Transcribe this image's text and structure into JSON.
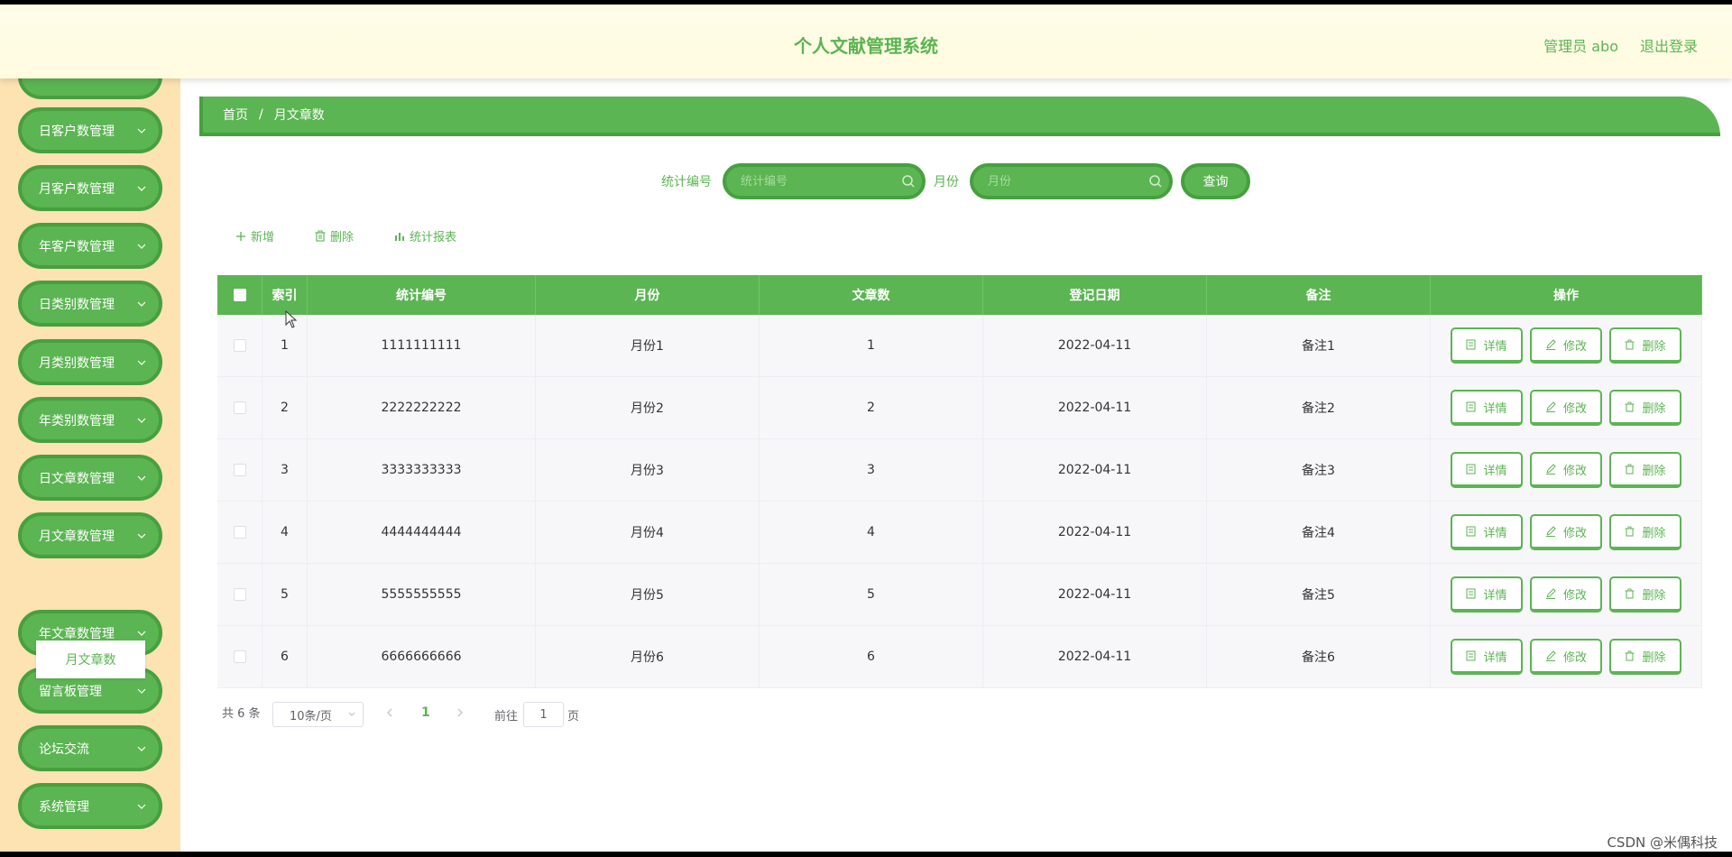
{
  "header": {
    "title": "个人文献管理系统",
    "user": "管理员 abo",
    "logout": "退出登录"
  },
  "sidebar": {
    "items": [
      {
        "label": "日客户数管理"
      },
      {
        "label": "月客户数管理"
      },
      {
        "label": "年客户数管理"
      },
      {
        "label": "日类别数管理"
      },
      {
        "label": "月类别数管理"
      },
      {
        "label": "年类别数管理"
      },
      {
        "label": "日文章数管理"
      },
      {
        "label": "月文章数管理"
      },
      {
        "label": "年文章数管理"
      },
      {
        "label": "留言板管理"
      },
      {
        "label": "论坛交流"
      },
      {
        "label": "系统管理"
      }
    ],
    "submenu": "月文章数"
  },
  "breadcrumb": {
    "home": "首页",
    "separator": "/",
    "current": "月文章数"
  },
  "search": {
    "code_label": "统计编号",
    "code_placeholder": "统计编号",
    "month_label": "月份",
    "month_placeholder": "月份",
    "query": "查询"
  },
  "toolbar": {
    "add": "新增",
    "delete": "删除",
    "report": "统计报表"
  },
  "table": {
    "columns": [
      "索引",
      "统计编号",
      "月份",
      "文章数",
      "登记日期",
      "备注",
      "操作"
    ],
    "rows": [
      {
        "index": "1",
        "code": "1111111111",
        "month": "月份1",
        "count": "1",
        "date": "2022-04-11",
        "note": "备注1"
      },
      {
        "index": "2",
        "code": "2222222222",
        "month": "月份2",
        "count": "2",
        "date": "2022-04-11",
        "note": "备注2"
      },
      {
        "index": "3",
        "code": "3333333333",
        "month": "月份3",
        "count": "3",
        "date": "2022-04-11",
        "note": "备注3"
      },
      {
        "index": "4",
        "code": "4444444444",
        "month": "月份4",
        "count": "4",
        "date": "2022-04-11",
        "note": "备注4"
      },
      {
        "index": "5",
        "code": "5555555555",
        "month": "月份5",
        "count": "5",
        "date": "2022-04-11",
        "note": "备注5"
      },
      {
        "index": "6",
        "code": "6666666666",
        "month": "月份6",
        "count": "6",
        "date": "2022-04-11",
        "note": "备注6"
      }
    ],
    "ops": {
      "detail": "详情",
      "edit": "修改",
      "delete": "删除"
    }
  },
  "pagination": {
    "total": "共 6 条",
    "page_size": "10条/页",
    "current": "1",
    "goto_prefix": "前往",
    "goto_value": "1",
    "goto_suffix": "页"
  },
  "watermark": "CSDN @米偶科技",
  "colors": {
    "accent": "#5bb552",
    "accent_dark": "#46a03e",
    "sidebar_bg": "#fde2b2",
    "header_bg": "#fffde9"
  }
}
